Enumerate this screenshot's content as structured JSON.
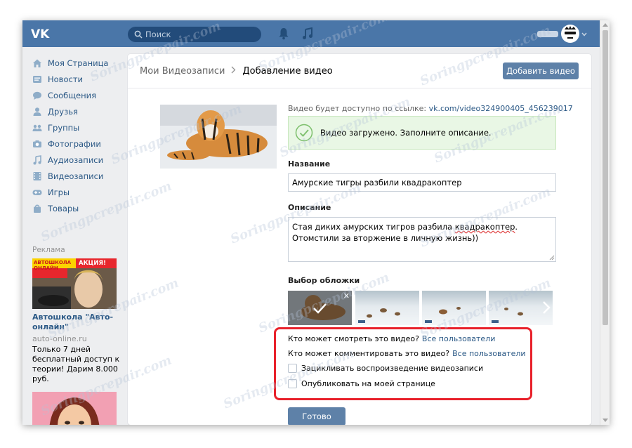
{
  "header": {
    "search_placeholder": "Поиск",
    "logo_icon": "vk-logo-icon",
    "notification_icon": "bell-icon",
    "music_icon": "music-icon",
    "accent_color": "#4a76a8"
  },
  "sidebar": {
    "items": [
      {
        "label": "Моя Страница",
        "icon": "home-icon"
      },
      {
        "label": "Новости",
        "icon": "news-icon"
      },
      {
        "label": "Сообщения",
        "icon": "messages-icon"
      },
      {
        "label": "Друзья",
        "icon": "friend-icon"
      },
      {
        "label": "Группы",
        "icon": "groups-icon"
      },
      {
        "label": "Фотографии",
        "icon": "camera-icon"
      },
      {
        "label": "Аудиозаписи",
        "icon": "music-note-icon"
      },
      {
        "label": "Видеозаписи",
        "icon": "film-icon"
      },
      {
        "label": "Игры",
        "icon": "gamepad-icon"
      },
      {
        "label": "Товары",
        "icon": "bag-icon"
      }
    ],
    "ads_title": "Реклама",
    "ad": {
      "title": "Автошкола \"Авто-онлайн\"",
      "domain": "auto-online.ru",
      "text": "Только 7 дней бесплатный доступ к теории! Дарим 8.000 руб.",
      "banner_brand": "АВТОШКОЛА ОНЛАЙН",
      "banner_promo": "АКЦИЯ!"
    }
  },
  "main": {
    "breadcrumb_parent": "Мои Видеозаписи",
    "breadcrumb_current": "Добавление видео",
    "add_video_button": "Добавить видео",
    "link_prefix": "Видео будет доступно по ссылке:",
    "link_url": "vk.com/video324900405_456239017",
    "success_message": "Видео загружено. Заполните описание.",
    "title_label": "Название",
    "title_value": "Амурские тигры разбили квадракоптер",
    "description_label": "Описание",
    "description_before": "Стая диких амурских тигров разбила ",
    "description_misspelled": "квадракоптер",
    "description_after": ". Отомстили за вторжение в личную жизнь))",
    "cover_label": "Выбор обложки",
    "privacy_view_label": "Кто может смотреть это видео?",
    "privacy_view_value": "Все пользователи",
    "privacy_comment_label": "Кто может комментировать это видео?",
    "privacy_comment_value": "Все пользователи",
    "loop_label": "Зацикливать воспроизведение видеозаписи",
    "publish_label": "Опубликовать на моей странице",
    "done_button": "Готово"
  },
  "watermark": "Soringpcrepair.com"
}
